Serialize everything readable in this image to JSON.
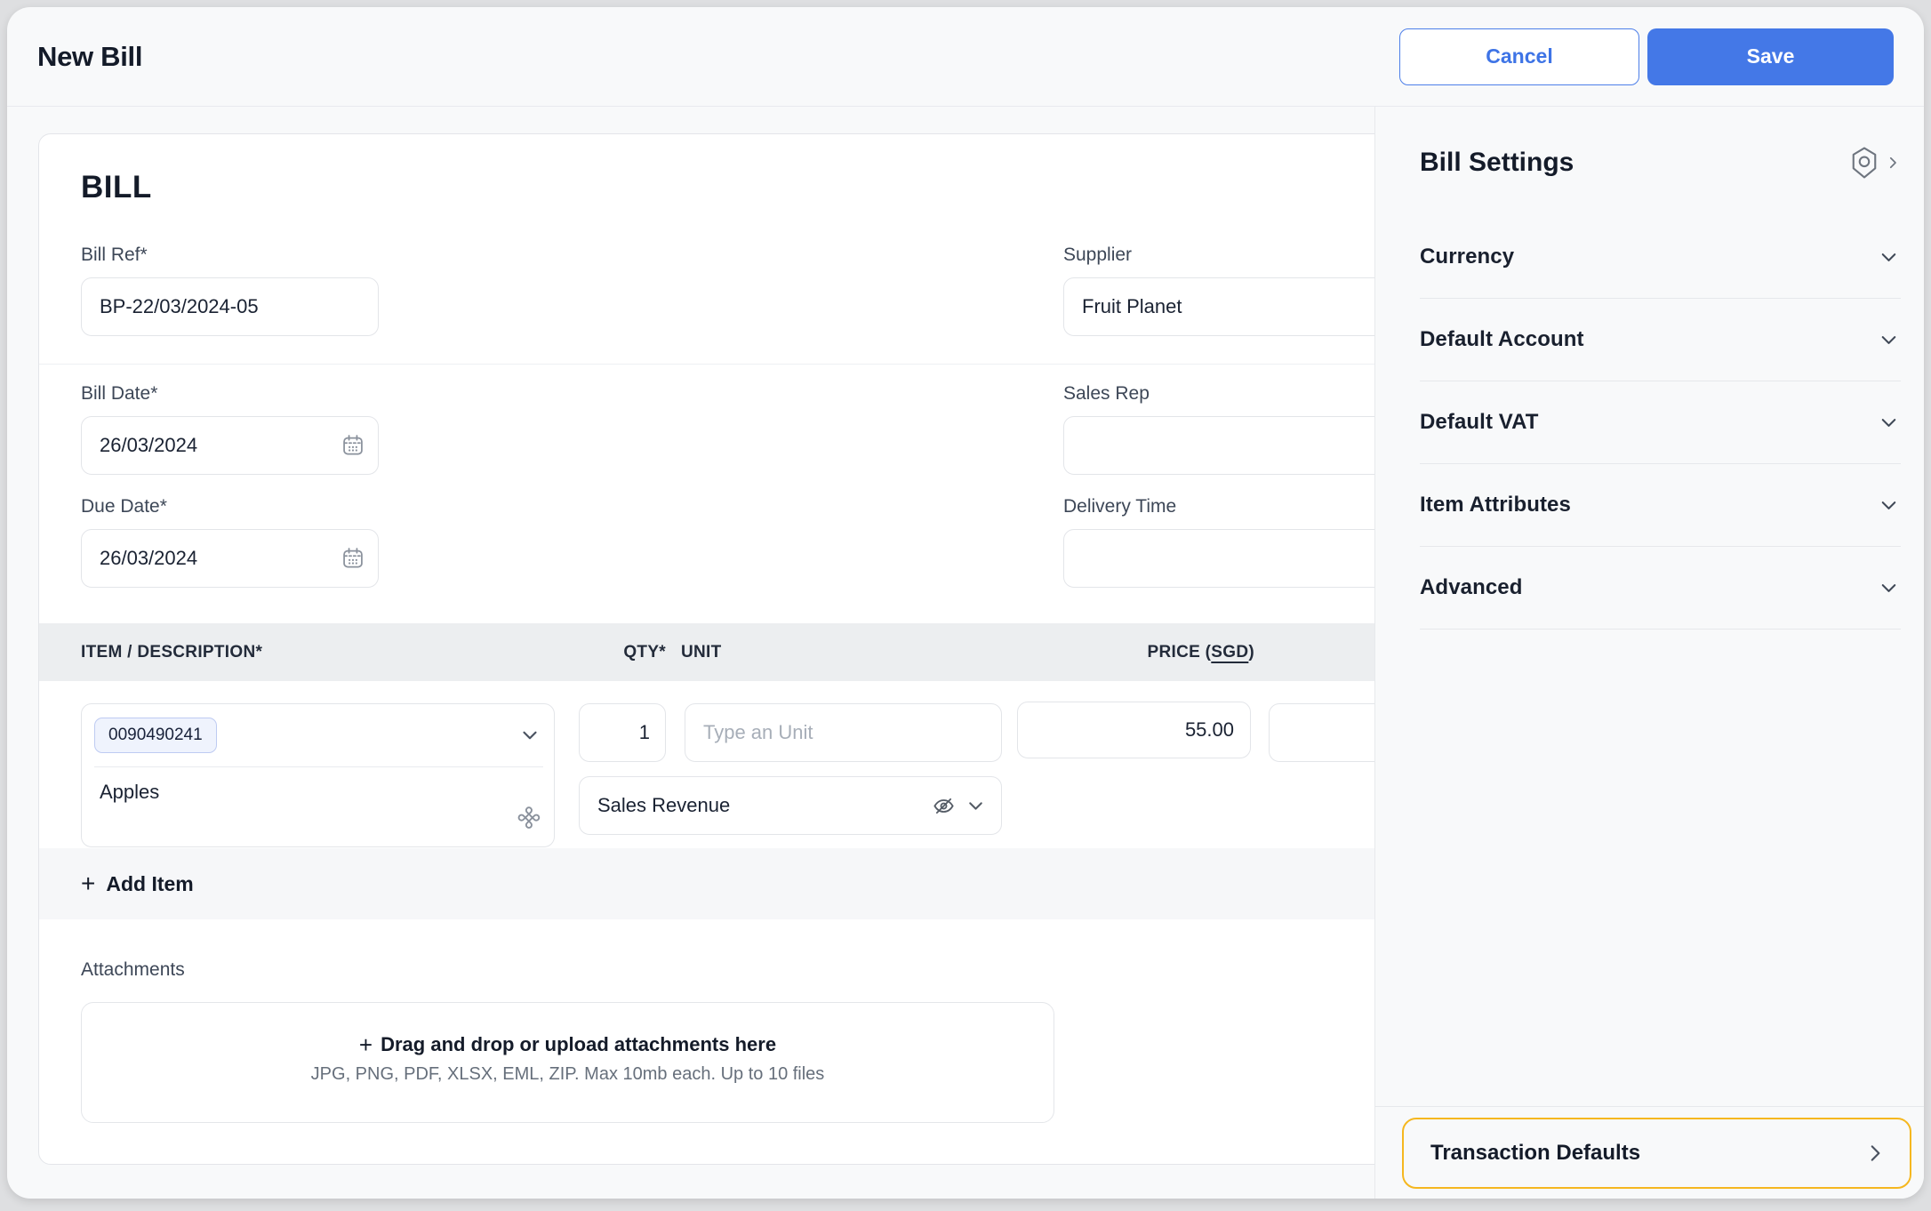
{
  "topbar": {
    "title": "New Bill",
    "cancel_label": "Cancel",
    "save_label": "Save"
  },
  "bill": {
    "heading": "BILL",
    "fields": {
      "bill_ref": {
        "label": "Bill Ref*",
        "value": "BP-22/03/2024-05"
      },
      "supplier": {
        "label": "Supplier",
        "value": "Fruit Planet"
      },
      "bill_date": {
        "label": "Bill Date*",
        "value": "26/03/2024"
      },
      "sales_rep": {
        "label": "Sales Rep",
        "value": ""
      },
      "due_date": {
        "label": "Due Date*",
        "value": "26/03/2024"
      },
      "delivery_time": {
        "label": "Delivery Time",
        "value": ""
      }
    },
    "items_table": {
      "headers": {
        "item": "ITEM / DESCRIPTION*",
        "qty": "QTY*",
        "unit": "UNIT",
        "price_prefix": "PRICE (",
        "price_currency": "SGD",
        "price_suffix": ")"
      },
      "row": {
        "item_code": "0090490241",
        "description": "Apples",
        "qty": "1",
        "unit_placeholder": "Type an Unit",
        "account": "Sales Revenue",
        "price": "55.00"
      },
      "add_item_label": "Add Item"
    },
    "attachments": {
      "label": "Attachments",
      "dropzone_title": "Drag and drop or upload attachments here",
      "dropzone_hint": "JPG, PNG, PDF, XLSX, EML, ZIP. Max 10mb each. Up to 10 files"
    }
  },
  "settings_panel": {
    "title": "Bill Settings",
    "sections": [
      {
        "label": "Currency"
      },
      {
        "label": "Default Account"
      },
      {
        "label": "Default VAT"
      },
      {
        "label": "Item Attributes"
      },
      {
        "label": "Advanced"
      }
    ],
    "footer_item": {
      "label": "Transaction Defaults"
    }
  },
  "icons": {
    "plus": "+",
    "ai": "⌘"
  },
  "colors": {
    "accent_blue": "#4478E7",
    "highlight_yellow": "#F5B71F"
  }
}
